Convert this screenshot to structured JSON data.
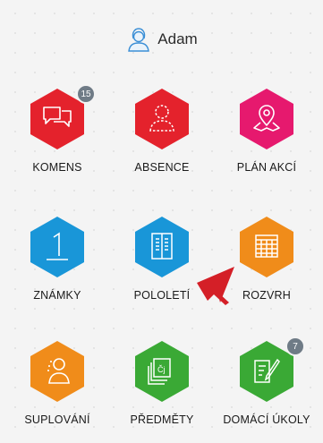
{
  "user": {
    "name": "Adam",
    "avatar_icon": "user-avatar-icon"
  },
  "tiles": [
    {
      "label": "KOMENS",
      "color": "#e4222c",
      "icon": "chat-bubbles-icon",
      "badge": "15"
    },
    {
      "label": "ABSENCE",
      "color": "#e4222c",
      "icon": "user-outline-icon"
    },
    {
      "label": "PLÁN AKCÍ",
      "color": "#e6196e",
      "icon": "map-pin-icon"
    },
    {
      "label": "ZNÁMKY",
      "color": "#1996d8",
      "icon": "grade-one-icon"
    },
    {
      "label": "POLOLETÍ",
      "color": "#1996d8",
      "icon": "report-book-icon"
    },
    {
      "label": "ROZVRH",
      "color": "#f08c1a",
      "icon": "timetable-grid-icon"
    },
    {
      "label": "SUPLOVÁNÍ",
      "color": "#f08c1a",
      "icon": "substitute-person-icon"
    },
    {
      "label": "PŘEDMĚTY",
      "color": "#3aa935",
      "icon": "subjects-cards-icon"
    },
    {
      "label": "DOMÁCÍ ÚKOLY",
      "color": "#3aa935",
      "icon": "homework-pencil-icon",
      "badge": "7"
    }
  ],
  "pointer_color": "#d41f27"
}
